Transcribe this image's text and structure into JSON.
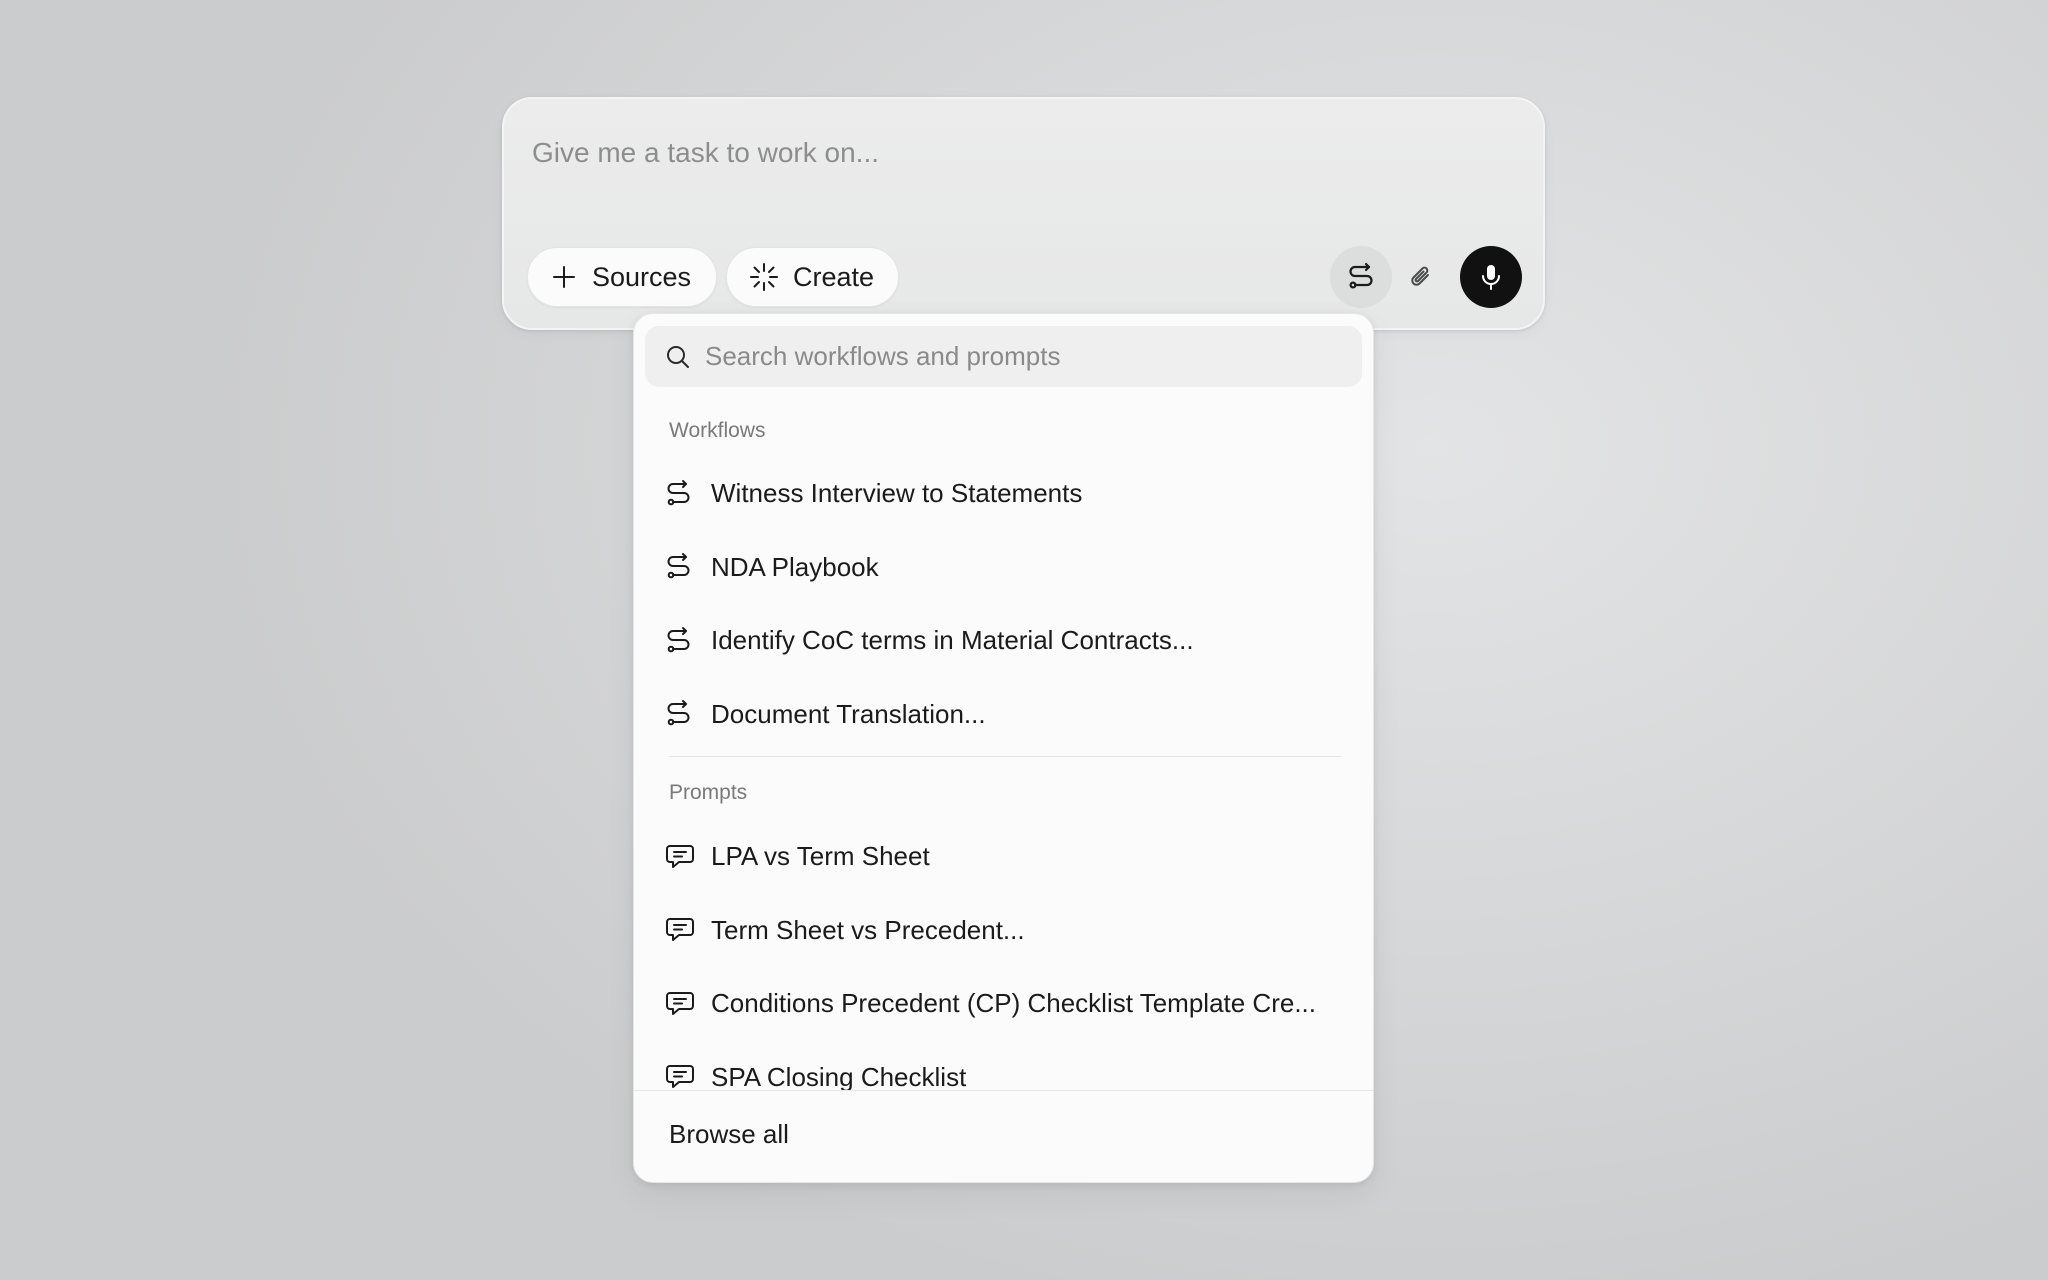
{
  "composer": {
    "placeholder": "Give me a task to work on...",
    "sources_label": "Sources",
    "create_label": "Create",
    "icons": {
      "sources": "plus-icon",
      "create": "sparkle-loader-icon",
      "workflows_button": "workflow-icon",
      "attach_button": "paperclip-icon",
      "mic_button": "microphone-icon"
    }
  },
  "dropdown": {
    "search_placeholder": "Search workflows and prompts",
    "workflows_heading": "Workflows",
    "workflows": [
      {
        "label": "Witness Interview to Statements"
      },
      {
        "label": "NDA Playbook"
      },
      {
        "label": "Identify CoC terms in Material Contracts..."
      },
      {
        "label": "Document Translation..."
      }
    ],
    "prompts_heading": "Prompts",
    "prompts": [
      {
        "label": "LPA vs Term Sheet"
      },
      {
        "label": "Term Sheet vs Precedent..."
      },
      {
        "label": "Conditions Precedent (CP) Checklist Template Cre..."
      },
      {
        "label": "SPA Closing Checklist"
      }
    ],
    "browse_all_label": "Browse all"
  },
  "colors": {
    "mic_button_bg": "#111111",
    "background": "#d6d7d8",
    "panel": "#fbfbfb"
  }
}
